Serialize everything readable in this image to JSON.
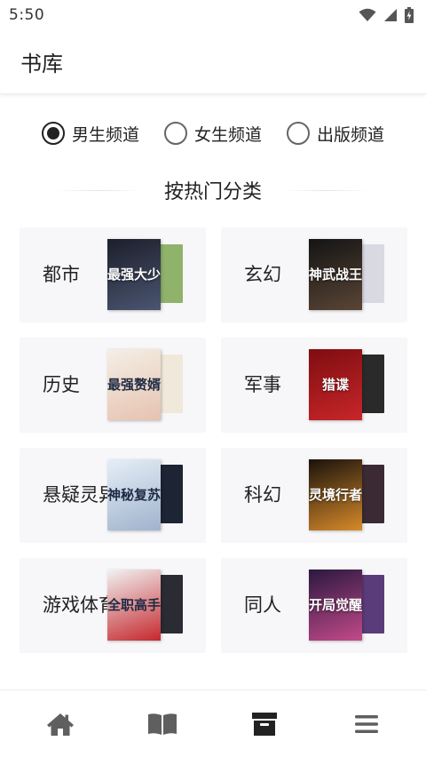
{
  "status_bar": {
    "time": "5:50"
  },
  "header": {
    "title": "书库"
  },
  "channels": [
    {
      "label": "男生频道",
      "checked": true
    },
    {
      "label": "女生频道",
      "checked": false
    },
    {
      "label": "出版频道",
      "checked": false
    }
  ],
  "section": {
    "title": "按热门分类"
  },
  "categories": [
    {
      "label": "都市",
      "cover_text": "最强大少",
      "front_colors": [
        "#1c1f2b",
        "#4a5570"
      ],
      "back_color": "#8fb36a"
    },
    {
      "label": "玄幻",
      "cover_text": "神武战王",
      "front_colors": [
        "#141414",
        "#5a4535"
      ],
      "back_color": "#d9d9e2"
    },
    {
      "label": "历史",
      "cover_text": "最强赘婿",
      "front_colors": [
        "#f4efe6",
        "#e6c2b0"
      ],
      "back_color": "#f0e8da"
    },
    {
      "label": "军事",
      "cover_text": "猎谍",
      "front_colors": [
        "#7e0d10",
        "#c8262a"
      ],
      "back_color": "#2a2a2a"
    },
    {
      "label": "悬疑灵异",
      "cover_text": "神秘复苏",
      "front_colors": [
        "#e6eef7",
        "#9fb3cc"
      ],
      "back_color": "#1d2433"
    },
    {
      "label": "科幻",
      "cover_text": "灵境行者",
      "front_colors": [
        "#1a120c",
        "#d78a2a"
      ],
      "back_color": "#3b2a34"
    },
    {
      "label": "游戏体育",
      "cover_text": "全职高手",
      "front_colors": [
        "#f2f2f2",
        "#c4282d"
      ],
      "back_color": "#2b2b33"
    },
    {
      "label": "同人",
      "cover_text": "开局觉醒",
      "front_colors": [
        "#2b1840",
        "#c24a8a"
      ],
      "back_color": "#5a3c7a"
    }
  ],
  "bottom_nav": [
    {
      "name": "home-icon",
      "active": false
    },
    {
      "name": "book-icon",
      "active": false
    },
    {
      "name": "archive-icon",
      "active": true
    },
    {
      "name": "menu-icon",
      "active": false
    }
  ],
  "colors": {
    "text": "#222222",
    "card_bg": "#f7f7f9",
    "nav_inactive": "#5f5f5f",
    "nav_active": "#222222"
  }
}
